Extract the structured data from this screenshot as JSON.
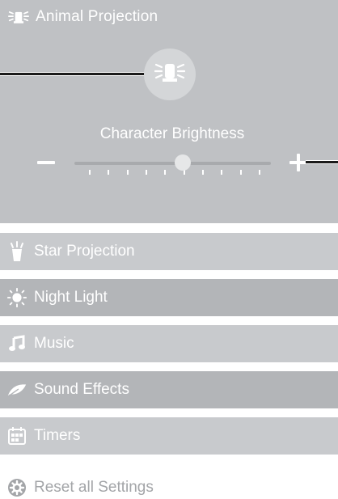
{
  "header": {
    "title": "Animal Projection",
    "icon": "beacon-icon"
  },
  "brightness": {
    "label": "Character Brightness",
    "value_fraction": 0.55,
    "tick_count": 10
  },
  "menu": {
    "items": [
      {
        "label": "Star Projection",
        "icon": "flashlight-icon"
      },
      {
        "label": "Night Light",
        "icon": "sun-icon"
      },
      {
        "label": "Music",
        "icon": "music-note-icon"
      },
      {
        "label": "Sound Effects",
        "icon": "leaf-icon"
      },
      {
        "label": "Timers",
        "icon": "calendar-icon"
      }
    ]
  },
  "reset": {
    "label": "Reset all Settings",
    "icon": "gear-icon"
  },
  "colors": {
    "panel": "#bfc1c4",
    "item_light": "#c8cacd",
    "item_dark": "#b3b5b8",
    "reset_text": "#a3a5a8"
  }
}
